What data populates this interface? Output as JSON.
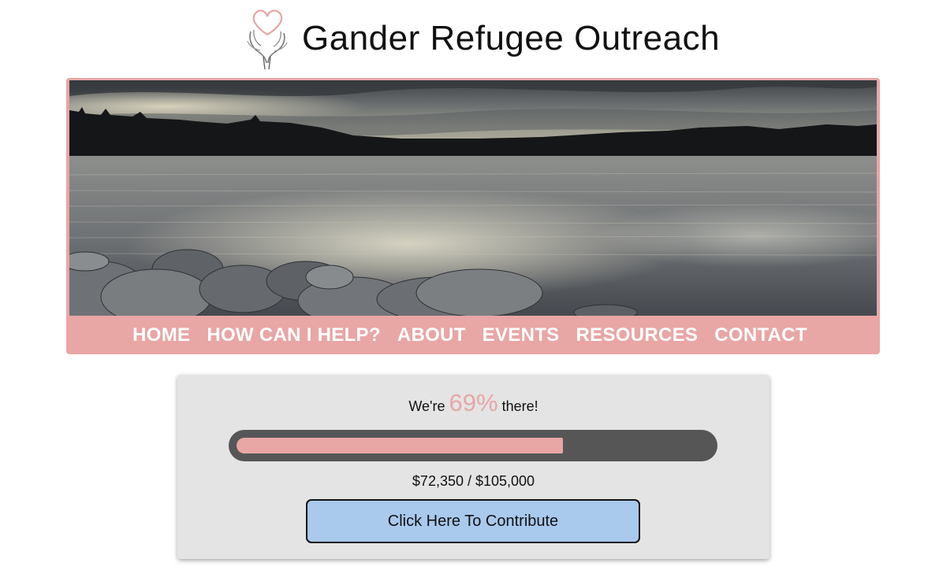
{
  "header": {
    "title": "Gander Refugee Outreach"
  },
  "nav": {
    "items": [
      {
        "label": "HOME"
      },
      {
        "label": "HOW CAN I HELP?"
      },
      {
        "label": "ABOUT"
      },
      {
        "label": "EVENTS"
      },
      {
        "label": "RESOURCES"
      },
      {
        "label": "CONTACT"
      }
    ]
  },
  "fundraiser": {
    "prefix": "We're",
    "percent_text": "69%",
    "suffix": "there!",
    "progress_fraction": 0.69,
    "amount_text": "$72,350 / $105,000",
    "button_label": "Click Here To Contribute"
  },
  "colors": {
    "accent": "#e8a6a5",
    "button": "#a9c9ed",
    "track": "#565656",
    "card": "#e4e4e4"
  }
}
